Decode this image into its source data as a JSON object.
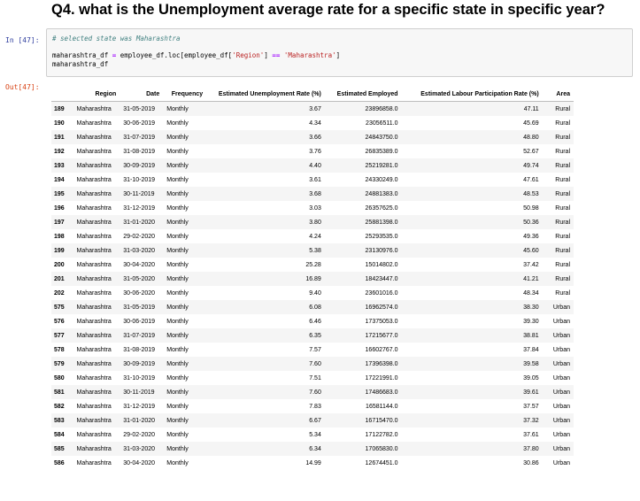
{
  "heading": "Q4. what is the Unemployment average rate for a specific state in specific year?",
  "prompts": {
    "in": "In [47]:",
    "out": "Out[47]:"
  },
  "code": {
    "comment": "# selected state was Maharashtra",
    "line2_a": "maharashtra_df ",
    "line2_eq": "=",
    "line2_b": " employee_df.loc[employee_df[",
    "line2_str1": "'Region'",
    "line2_c": "] ",
    "line2_op": "==",
    "line2_d": " ",
    "line2_str2": "'Maharashtra'",
    "line2_e": "]",
    "line3": "maharashtra_df"
  },
  "table": {
    "columns": [
      "",
      "Region",
      "Date",
      "Frequency",
      "Estimated Unemployment Rate (%)",
      "Estimated Employed",
      "Estimated Labour Participation Rate (%)",
      "Area"
    ],
    "rows": [
      [
        "189",
        "Maharashtra",
        "31-05-2019",
        "Monthly",
        "3.67",
        "23896858.0",
        "47.11",
        "Rural"
      ],
      [
        "190",
        "Maharashtra",
        "30-06-2019",
        "Monthly",
        "4.34",
        "23056511.0",
        "45.69",
        "Rural"
      ],
      [
        "191",
        "Maharashtra",
        "31-07-2019",
        "Monthly",
        "3.66",
        "24843750.0",
        "48.80",
        "Rural"
      ],
      [
        "192",
        "Maharashtra",
        "31-08-2019",
        "Monthly",
        "3.76",
        "26835389.0",
        "52.67",
        "Rural"
      ],
      [
        "193",
        "Maharashtra",
        "30-09-2019",
        "Monthly",
        "4.40",
        "25219281.0",
        "49.74",
        "Rural"
      ],
      [
        "194",
        "Maharashtra",
        "31-10-2019",
        "Monthly",
        "3.61",
        "24330249.0",
        "47.61",
        "Rural"
      ],
      [
        "195",
        "Maharashtra",
        "30-11-2019",
        "Monthly",
        "3.68",
        "24881383.0",
        "48.53",
        "Rural"
      ],
      [
        "196",
        "Maharashtra",
        "31-12-2019",
        "Monthly",
        "3.03",
        "26357625.0",
        "50.98",
        "Rural"
      ],
      [
        "197",
        "Maharashtra",
        "31-01-2020",
        "Monthly",
        "3.80",
        "25881398.0",
        "50.36",
        "Rural"
      ],
      [
        "198",
        "Maharashtra",
        "29-02-2020",
        "Monthly",
        "4.24",
        "25293535.0",
        "49.36",
        "Rural"
      ],
      [
        "199",
        "Maharashtra",
        "31-03-2020",
        "Monthly",
        "5.38",
        "23130976.0",
        "45.60",
        "Rural"
      ],
      [
        "200",
        "Maharashtra",
        "30-04-2020",
        "Monthly",
        "25.28",
        "15014802.0",
        "37.42",
        "Rural"
      ],
      [
        "201",
        "Maharashtra",
        "31-05-2020",
        "Monthly",
        "16.89",
        "18423447.0",
        "41.21",
        "Rural"
      ],
      [
        "202",
        "Maharashtra",
        "30-06-2020",
        "Monthly",
        "9.40",
        "23601016.0",
        "48.34",
        "Rural"
      ],
      [
        "575",
        "Maharashtra",
        "31-05-2019",
        "Monthly",
        "6.08",
        "16962574.0",
        "38.30",
        "Urban"
      ],
      [
        "576",
        "Maharashtra",
        "30-06-2019",
        "Monthly",
        "6.46",
        "17375053.0",
        "39.30",
        "Urban"
      ],
      [
        "577",
        "Maharashtra",
        "31-07-2019",
        "Monthly",
        "6.35",
        "17215677.0",
        "38.81",
        "Urban"
      ],
      [
        "578",
        "Maharashtra",
        "31-08-2019",
        "Monthly",
        "7.57",
        "16602767.0",
        "37.84",
        "Urban"
      ],
      [
        "579",
        "Maharashtra",
        "30-09-2019",
        "Monthly",
        "7.60",
        "17396398.0",
        "39.58",
        "Urban"
      ],
      [
        "580",
        "Maharashtra",
        "31-10-2019",
        "Monthly",
        "7.51",
        "17221991.0",
        "39.05",
        "Urban"
      ],
      [
        "581",
        "Maharashtra",
        "30-11-2019",
        "Monthly",
        "7.60",
        "17486683.0",
        "39.61",
        "Urban"
      ],
      [
        "582",
        "Maharashtra",
        "31-12-2019",
        "Monthly",
        "7.83",
        "16581144.0",
        "37.57",
        "Urban"
      ],
      [
        "583",
        "Maharashtra",
        "31-01-2020",
        "Monthly",
        "6.67",
        "16715470.0",
        "37.32",
        "Urban"
      ],
      [
        "584",
        "Maharashtra",
        "29-02-2020",
        "Monthly",
        "5.34",
        "17122782.0",
        "37.61",
        "Urban"
      ],
      [
        "585",
        "Maharashtra",
        "31-03-2020",
        "Monthly",
        "6.34",
        "17065830.0",
        "37.80",
        "Urban"
      ],
      [
        "586",
        "Maharashtra",
        "30-04-2020",
        "Monthly",
        "14.99",
        "12674451.0",
        "30.86",
        "Urban"
      ]
    ]
  }
}
